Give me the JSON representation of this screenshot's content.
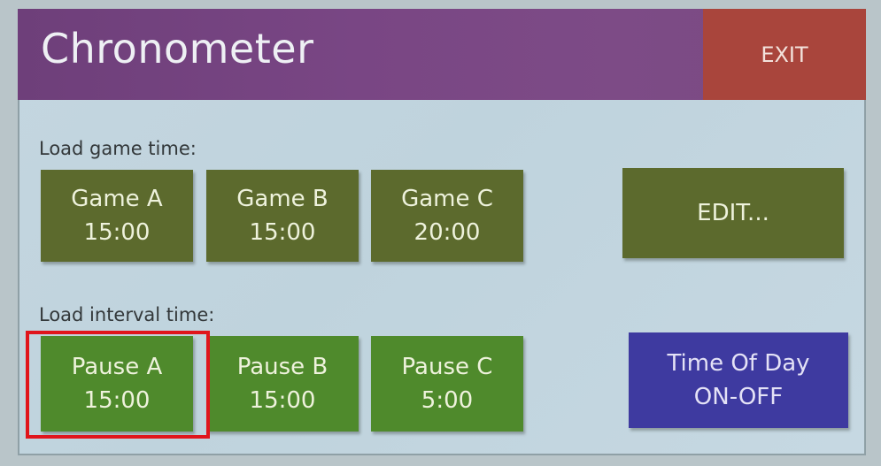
{
  "header": {
    "title": "Chronometer",
    "exit_label": "EXIT"
  },
  "game_section": {
    "label": "Load game time:",
    "buttons": [
      {
        "name": "Game A",
        "time": "15:00"
      },
      {
        "name": "Game B",
        "time": "15:00"
      },
      {
        "name": "Game C",
        "time": "20:00"
      }
    ],
    "edit_label": "EDIT..."
  },
  "interval_section": {
    "label": "Load interval time:",
    "buttons": [
      {
        "name": "Pause A",
        "time": "15:00"
      },
      {
        "name": "Pause B",
        "time": "15:00"
      },
      {
        "name": "Pause C",
        "time": "5:00"
      }
    ],
    "time_of_day": {
      "line1": "Time Of Day",
      "line2": "ON-OFF"
    }
  },
  "colors": {
    "header": "#7a4684",
    "exit": "#a9453c",
    "game_button": "#5c6a2d",
    "pause_button": "#4f8a2c",
    "time_of_day_button": "#3e3aa0",
    "highlight": "#e0151c"
  }
}
